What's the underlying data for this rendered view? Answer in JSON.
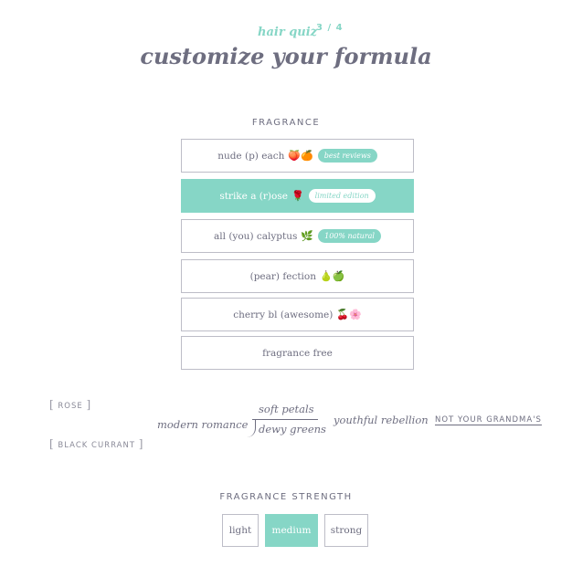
{
  "header": {
    "quiz_label": "hair quiz",
    "step": "3 / 4",
    "title": "customize your formula"
  },
  "fragrance": {
    "section_title": "FRAGRANCE",
    "options": [
      {
        "label": "nude (p) each",
        "emoji": "🍑🍊",
        "badge": "best reviews",
        "selected": false
      },
      {
        "label": "strike a (r)ose",
        "emoji": "🌹",
        "badge": "limited edition",
        "selected": true
      },
      {
        "label": "all (you) calyptus",
        "emoji": "🌿",
        "badge": "100% natural",
        "selected": false
      },
      {
        "label": "(pear) fection",
        "emoji": "🍐🍏",
        "badge": "",
        "selected": false
      },
      {
        "label": "cherry bl (awesome)",
        "emoji": "🍒🌸",
        "badge": "",
        "selected": false
      },
      {
        "label": "fragrance free",
        "emoji": "",
        "badge": "",
        "selected": false
      }
    ]
  },
  "notes": {
    "bracket_open": "[",
    "bracket_close": "]",
    "rose": "ROSE",
    "black_currant": "BLACK CURRANT",
    "modern_romance": "modern romance",
    "soft_petals": "soft petals",
    "dewy_greens": "dewy greens",
    "youthful_rebellion": "youthful rebellion",
    "not_grandmas": "NOT YOUR GRANDMA'S"
  },
  "strength": {
    "section_title": "FRAGRANCE STRENGTH",
    "options": [
      {
        "label": "light",
        "selected": false
      },
      {
        "label": "medium",
        "selected": true
      },
      {
        "label": "strong",
        "selected": false
      }
    ]
  },
  "colors": {
    "accent": "#86d6c6",
    "text": "#6e6e80",
    "border": "#bdbdc7"
  }
}
